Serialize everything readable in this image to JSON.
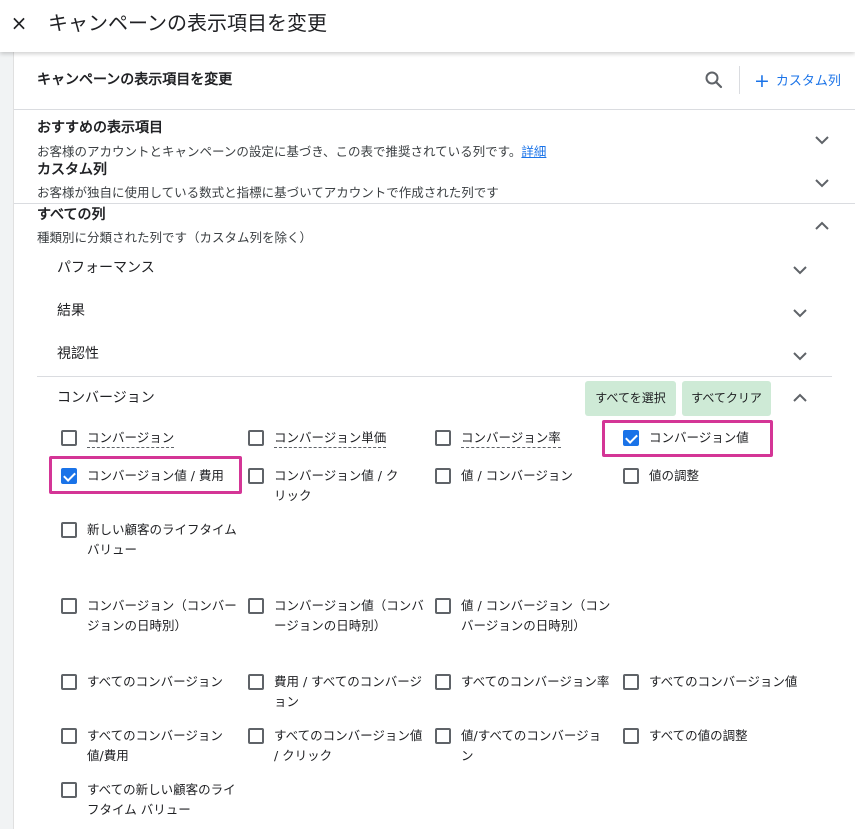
{
  "topbar": {
    "title": "キャンペーンの表示項目を変更",
    "close_icon": "×"
  },
  "panel": {
    "title": "キャンペーンの表示項目を変更",
    "custom_column_label": "カスタム列"
  },
  "sections": {
    "recommended": {
      "title": "おすすめの表示項目",
      "desc": "お客様のアカウントとキャンペーンの設定に基づき、この表で推奨されている列です。",
      "link": "詳細"
    },
    "custom": {
      "title": "カスタム列",
      "desc": "お客様が独自に使用している数式と指標に基づいてアカウントで作成された列です"
    },
    "all": {
      "title": "すべての列",
      "desc": "種類別に分類された列です（カスタム列を除く）"
    }
  },
  "subsections": {
    "performance": "パフォーマンス",
    "results": "結果",
    "visibility": "視認性",
    "conversions": "コンバージョン"
  },
  "buttons": {
    "select_all": "すべてを選択",
    "clear_all": "すべてクリア"
  },
  "checkboxes": {
    "conv": {
      "label": "コンバージョン",
      "checked": false
    },
    "conv_cost": {
      "label": "コンバージョン単価",
      "checked": false
    },
    "conv_rate": {
      "label": "コンバージョン率",
      "checked": false
    },
    "conv_value": {
      "label": "コンバージョン値",
      "checked": true
    },
    "conv_value_cost": {
      "label": "コンバージョン値 / 費用",
      "checked": true
    },
    "conv_value_click": {
      "label": "コンバージョン値 / クリック",
      "checked": false
    },
    "value_conv": {
      "label": "値 / コンバージョン",
      "checked": false
    },
    "value_adj": {
      "label": "値の調整",
      "checked": false
    },
    "new_cust_ltv": {
      "label": "新しい顧客のライフタイム バリュー",
      "checked": false
    },
    "conv_by_time": {
      "label": "コンバージョン（コンバージョンの日時別）",
      "checked": false
    },
    "conv_value_by_time": {
      "label": "コンバージョン値（コンバージョンの日時別）",
      "checked": false
    },
    "value_conv_by_time": {
      "label": "値 / コンバージョン（コンバージョンの日時別）",
      "checked": false
    },
    "all_conv": {
      "label": "すべてのコンバージョン",
      "checked": false
    },
    "cost_all_conv": {
      "label": "費用 / すべてのコンバージョン",
      "checked": false
    },
    "all_conv_rate": {
      "label": "すべてのコンバージョン率",
      "checked": false
    },
    "all_conv_value": {
      "label": "すべてのコンバージョン値",
      "checked": false
    },
    "all_conv_value_cost": {
      "label": "すべてのコンバージョン値/費用",
      "checked": false
    },
    "all_conv_value_click": {
      "label": "すべてのコンバージョン値 / クリック",
      "checked": false
    },
    "value_all_conv": {
      "label": "値/すべてのコンバージョン",
      "checked": false
    },
    "all_value_adj": {
      "label": "すべての値の調整",
      "checked": false
    },
    "all_new_cust_ltv": {
      "label": "すべての新しい顧客のライフタイム バリュー",
      "checked": false
    }
  },
  "colors": {
    "accent": "#1a73e8",
    "highlight": "#d43596",
    "button_bg": "#ceead6"
  }
}
